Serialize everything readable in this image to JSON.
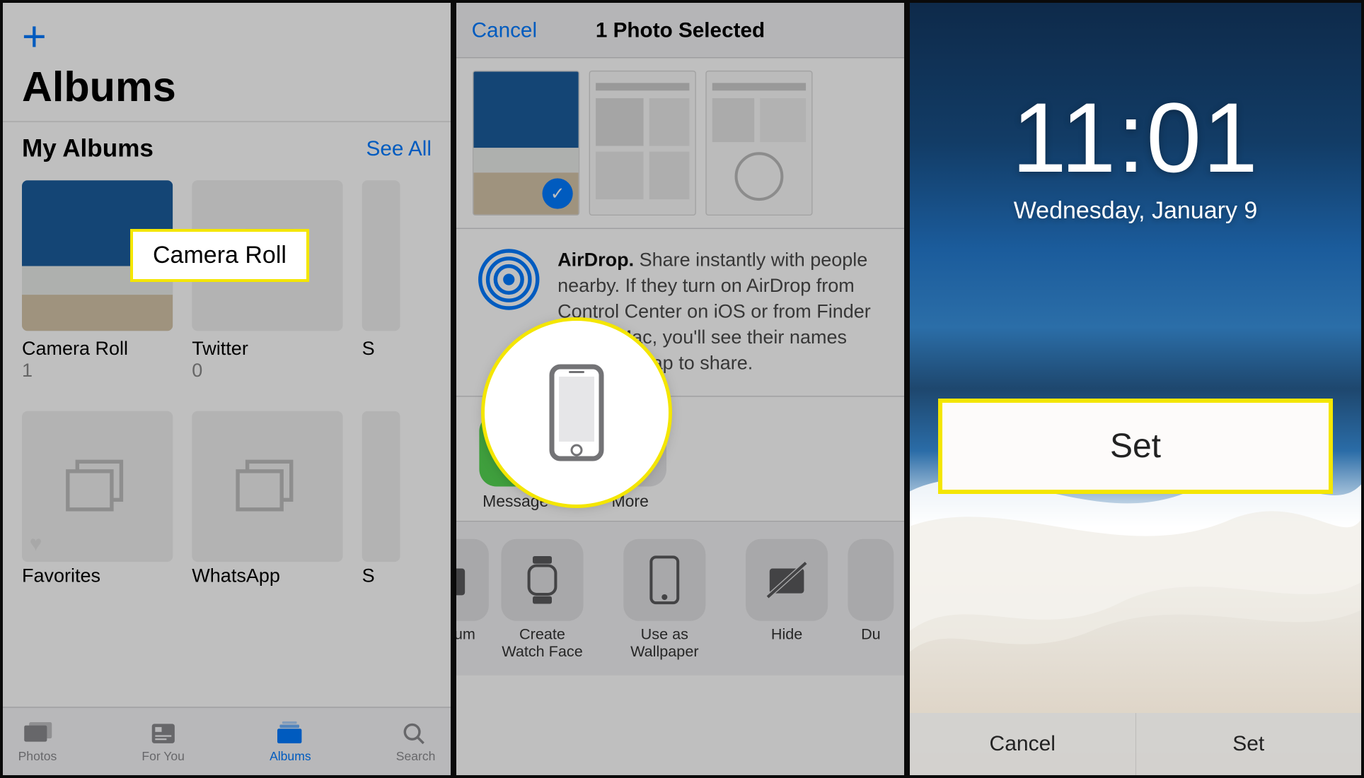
{
  "panel1": {
    "title": "Albums",
    "subheading": "My Albums",
    "see_all": "See All",
    "albums_row1": [
      {
        "name": "Camera Roll",
        "count": "1"
      },
      {
        "name": "Twitter",
        "count": "0"
      },
      {
        "name": "S",
        "count": ""
      }
    ],
    "albums_row2": [
      {
        "name": "Favorites",
        "count": ""
      },
      {
        "name": "WhatsApp",
        "count": ""
      },
      {
        "name": "S",
        "count": ""
      }
    ],
    "tabs": [
      "Photos",
      "For You",
      "Albums",
      "Search"
    ],
    "callout": "Camera Roll"
  },
  "panel2": {
    "cancel": "Cancel",
    "title": "1 Photo Selected",
    "airdrop_html": "AirDrop. Share instantly with people nearby. If they turn on AirDrop from Control Center on iOS or from Finder on the Mac, you'll see their names here. Just tap to share.",
    "app_items": [
      "Message",
      "More"
    ],
    "actions": [
      "o Album",
      "Create\nWatch Face",
      "Use as\nWallpaper",
      "Hide",
      "Du"
    ]
  },
  "panel3": {
    "time": "11:01",
    "date": "Wednesday, January 9",
    "callout": "Set",
    "buttons": [
      "Cancel",
      "Set"
    ]
  }
}
